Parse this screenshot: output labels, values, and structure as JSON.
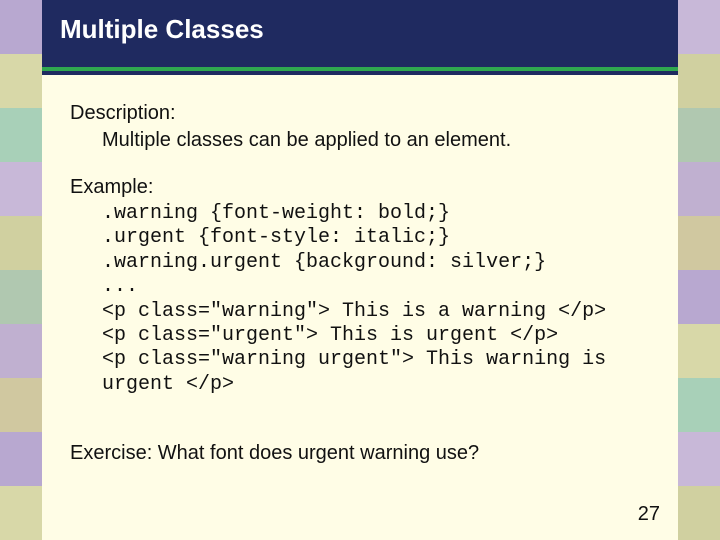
{
  "title": "Multiple Classes",
  "description": {
    "label": "Description:",
    "text": "Multiple classes can be applied to an element."
  },
  "example": {
    "label": "Example:",
    "code": ".warning {font-weight: bold;}\n.urgent {font-style: italic;}\n.warning.urgent {background: silver;}\n...\n<p class=\"warning\"> This is a warning </p>\n<p class=\"urgent\"> This is urgent </p>\n<p class=\"warning urgent\"> This warning is urgent </p>"
  },
  "exercise": "Exercise: What font does urgent warning use?",
  "page_number": "27"
}
